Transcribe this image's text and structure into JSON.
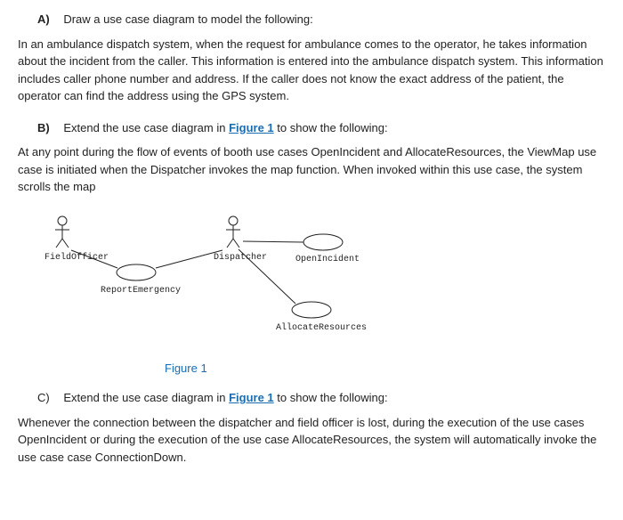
{
  "sectionA": {
    "letter": "A)",
    "title": "Draw a use case diagram to model the following:",
    "body": "In an ambulance dispatch system, when the request for ambulance comes to the operator, he takes information about the incident from the caller. This information is entered into the ambulance dispatch system. This information includes caller phone number and address. If the caller does not know the exact address of the patient, the operator can find the address using the GPS system."
  },
  "sectionB": {
    "letter": "B)",
    "title_pre": "Extend the use case diagram in ",
    "title_link": "Figure 1",
    "title_post": " to show the following:",
    "body": "At any point during the flow of events of booth use cases OpenIncident and AllocateResources, the ViewMap use case is initiated when the Dispatcher invokes the map function. When invoked within this use case, the system scrolls the map"
  },
  "diagram": {
    "fieldOfficer": "FieldOfficer",
    "dispatcher": "Dispatcher",
    "reportEmergency": "ReportEmergency",
    "openIncident": "OpenIncident",
    "allocateResources": "AllocateResources",
    "caption": "Figure 1"
  },
  "sectionC": {
    "letter": "C)",
    "title_pre": "Extend the use case diagram in ",
    "title_link": "Figure 1",
    "title_post": " to show the following:",
    "body": "Whenever the connection between the dispatcher and field officer is lost, during the execution of the use cases OpenIncident or during the execution of the use case AllocateResources, the system will automatically invoke the use case case ConnectionDown."
  }
}
